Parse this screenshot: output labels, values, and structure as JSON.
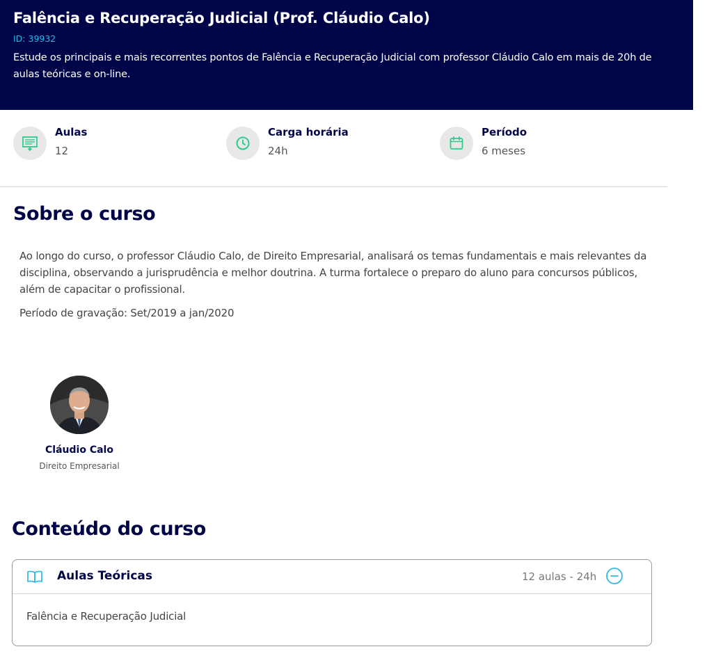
{
  "course": {
    "title": "Falência e Recuperação Judicial (Prof. Cláudio Calo)",
    "id_label": "ID: 39932",
    "description": "Estude os principais e mais recorrentes pontos de Falência e Recuperação Judicial com professor Cláudio Calo em mais de 20h de aulas teóricas e on-line."
  },
  "stats": [
    {
      "label": "Aulas",
      "value": "12",
      "icon": "presentation-icon"
    },
    {
      "label": "Carga horária",
      "value": "24h",
      "icon": "clock-icon"
    },
    {
      "label": "Período",
      "value": "6 meses",
      "icon": "calendar-icon"
    }
  ],
  "about": {
    "heading": "Sobre o curso",
    "text": "Ao longo do curso, o professor Cláudio Calo, de Direito Empresarial, analisará os temas fundamentais e mais relevantes da disciplina, observando a jurisprudência e melhor doutrina. A turma fortalece o preparo do aluno para concursos públicos, além de capacitar o profissional.",
    "recording_period": "Período de gravação: Set/2019 a jan/2020"
  },
  "teacher": {
    "name": "Cláudio Calo",
    "area": "Direito Empresarial"
  },
  "content": {
    "heading": "Conteúdo do curso",
    "modules": [
      {
        "title": "Aulas Teóricas",
        "meta": "12 aulas - 24h",
        "items": [
          "Falência e Recuperação Judicial"
        ]
      }
    ]
  },
  "colors": {
    "navy": "#000548",
    "accent_green": "#2ecc8a",
    "accent_cyan": "#2fb8e8"
  }
}
